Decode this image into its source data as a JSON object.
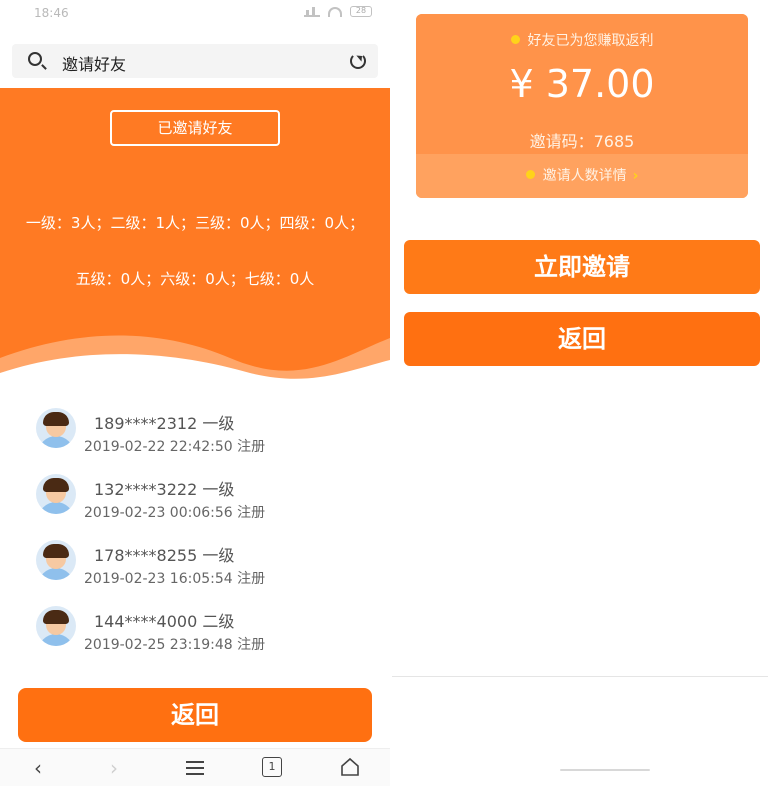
{
  "status": {
    "time": "18:46",
    "battery": "28"
  },
  "search": {
    "title": "邀请好友"
  },
  "hero": {
    "invited_button": "已邀请好友",
    "levels_line1": "一级：3人；二级：1人；三级：0人；四级：0人；",
    "levels_line2": "五级：0人；六级：0人；七级：0人"
  },
  "friends": [
    {
      "phone": "189****2312 一级",
      "date": "2019-02-22 22:42:50 注册"
    },
    {
      "phone": "132****3222 一级",
      "date": "2019-02-23 00:06:56 注册"
    },
    {
      "phone": "178****8255 一级",
      "date": "2019-02-23 16:05:54 注册"
    },
    {
      "phone": "144****4000 二级",
      "date": "2019-02-25 23:19:48 注册"
    }
  ],
  "left_actions": {
    "back": "返回"
  },
  "browser_nav": {
    "back": "‹",
    "forward": "›",
    "tabs_count": "1"
  },
  "earn_card": {
    "label": "好友已为您赚取返利",
    "amount": "¥ 37.00",
    "code": "邀请码：7685",
    "detail": "邀请人数详情"
  },
  "right_actions": {
    "invite": "立即邀请",
    "back": "返回"
  },
  "colors": {
    "primary_orange": "#ff7a23",
    "button_orange": "#ff7011",
    "card_orange": "#ff934a",
    "accent_yellow": "#ffd31a"
  }
}
